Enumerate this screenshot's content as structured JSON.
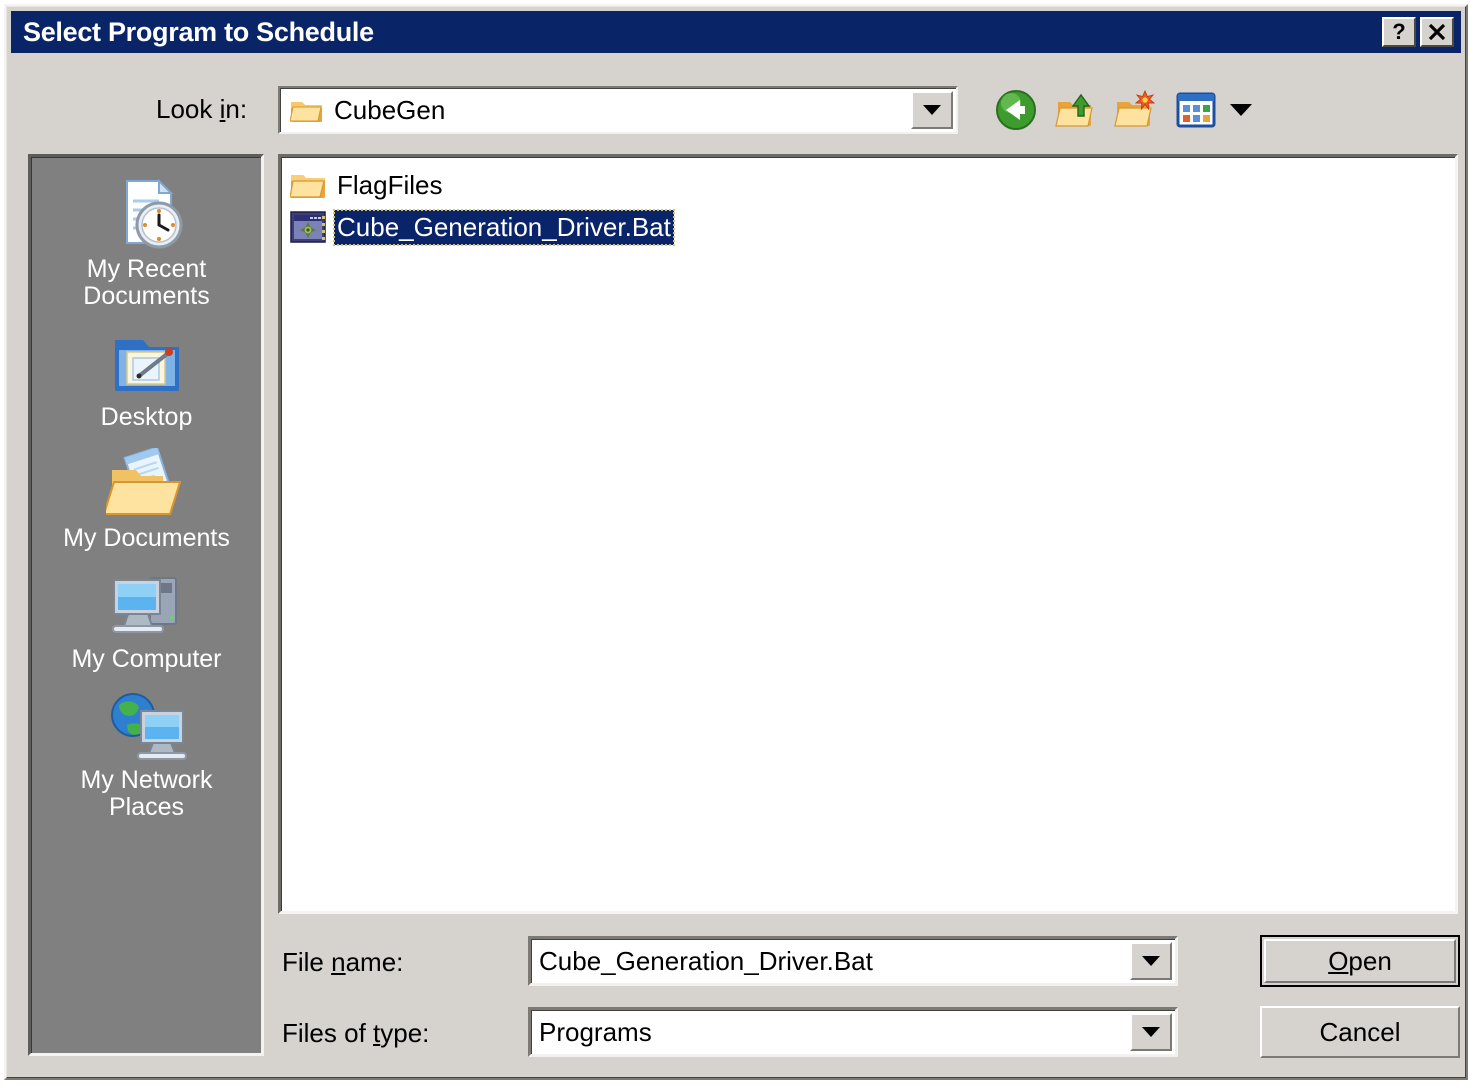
{
  "dialog": {
    "title": "Select Program to Schedule",
    "help_button": "?",
    "close_button": "✕"
  },
  "lookin": {
    "label_pre": "Look ",
    "label_accel": "i",
    "label_post": "n:",
    "value": "CubeGen",
    "icon": "folder-icon"
  },
  "toolbar": {
    "items": [
      {
        "name": "back-button",
        "icon": "back-arrow-icon",
        "tooltip": "Back"
      },
      {
        "name": "up-one-level-button",
        "icon": "up-folder-icon",
        "tooltip": "Up One Level"
      },
      {
        "name": "new-folder-button",
        "icon": "new-folder-icon",
        "tooltip": "Create New Folder"
      },
      {
        "name": "views-button",
        "icon": "views-icon",
        "tooltip": "Views"
      }
    ]
  },
  "places": {
    "items": [
      {
        "label": "My Recent\nDocuments",
        "icon": "recent-documents-icon"
      },
      {
        "label": "Desktop",
        "icon": "desktop-icon"
      },
      {
        "label": "My Documents",
        "icon": "my-documents-icon"
      },
      {
        "label": "My Computer",
        "icon": "my-computer-icon"
      },
      {
        "label": "My Network\nPlaces",
        "icon": "my-network-places-icon"
      }
    ]
  },
  "filelist": {
    "items": [
      {
        "name": "FlagFiles",
        "icon": "folder-icon",
        "selected": false
      },
      {
        "name": "Cube_Generation_Driver.Bat",
        "icon": "batch-file-icon",
        "selected": true
      }
    ]
  },
  "form": {
    "filename": {
      "label_pre": "File ",
      "label_accel": "n",
      "label_post": "ame:",
      "value": "Cube_Generation_Driver.Bat"
    },
    "filetype": {
      "label_pre": "Files of ",
      "label_accel": "t",
      "label_post": "ype:",
      "value": "Programs"
    }
  },
  "buttons": {
    "open": {
      "pre": "",
      "accel": "O",
      "post": "pen"
    },
    "cancel": {
      "label": "Cancel"
    }
  },
  "colors": {
    "titlebar": "#0a2468",
    "dialog_face": "#d6d2ce",
    "selection": "#0a246a",
    "places_bar": "#808080",
    "list_background": "#ffffff"
  }
}
